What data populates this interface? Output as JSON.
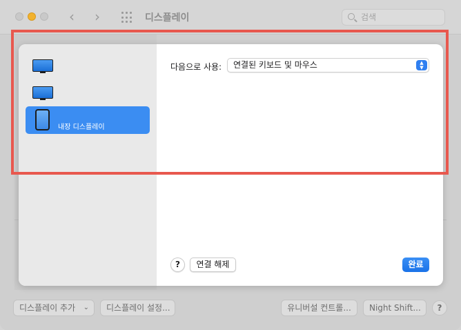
{
  "window": {
    "title": "디스플레이",
    "search_placeholder": "검색",
    "nav_back_icon": "chevron-left-icon",
    "nav_forward_icon": "chevron-right-icon",
    "grid_icon": "app-grid-icon"
  },
  "bottom_bar": {
    "add_display_label": "디스플레이 추가",
    "display_settings_label": "디스플레이 설정...",
    "universal_control_label": "유니버설 컨트롤...",
    "night_shift_label": "Night Shift...",
    "help_label": "?"
  },
  "sheet": {
    "sidebar": {
      "items": [
        {
          "icon": "monitor-icon",
          "label": ""
        },
        {
          "icon": "monitor-icon",
          "label": ""
        },
        {
          "icon": "ipad-icon",
          "label": "내장 디스플레이",
          "selected": true
        }
      ]
    },
    "use_as_label": "다음으로 사용:",
    "use_as_value": "연결된 키보드 및 마우스",
    "help_label": "?",
    "disconnect_label": "연결 해제",
    "done_label": "완료"
  },
  "colors": {
    "highlight": "#e8584e",
    "accent": "#2f7ff0",
    "selected_item": "#3b8df2"
  }
}
